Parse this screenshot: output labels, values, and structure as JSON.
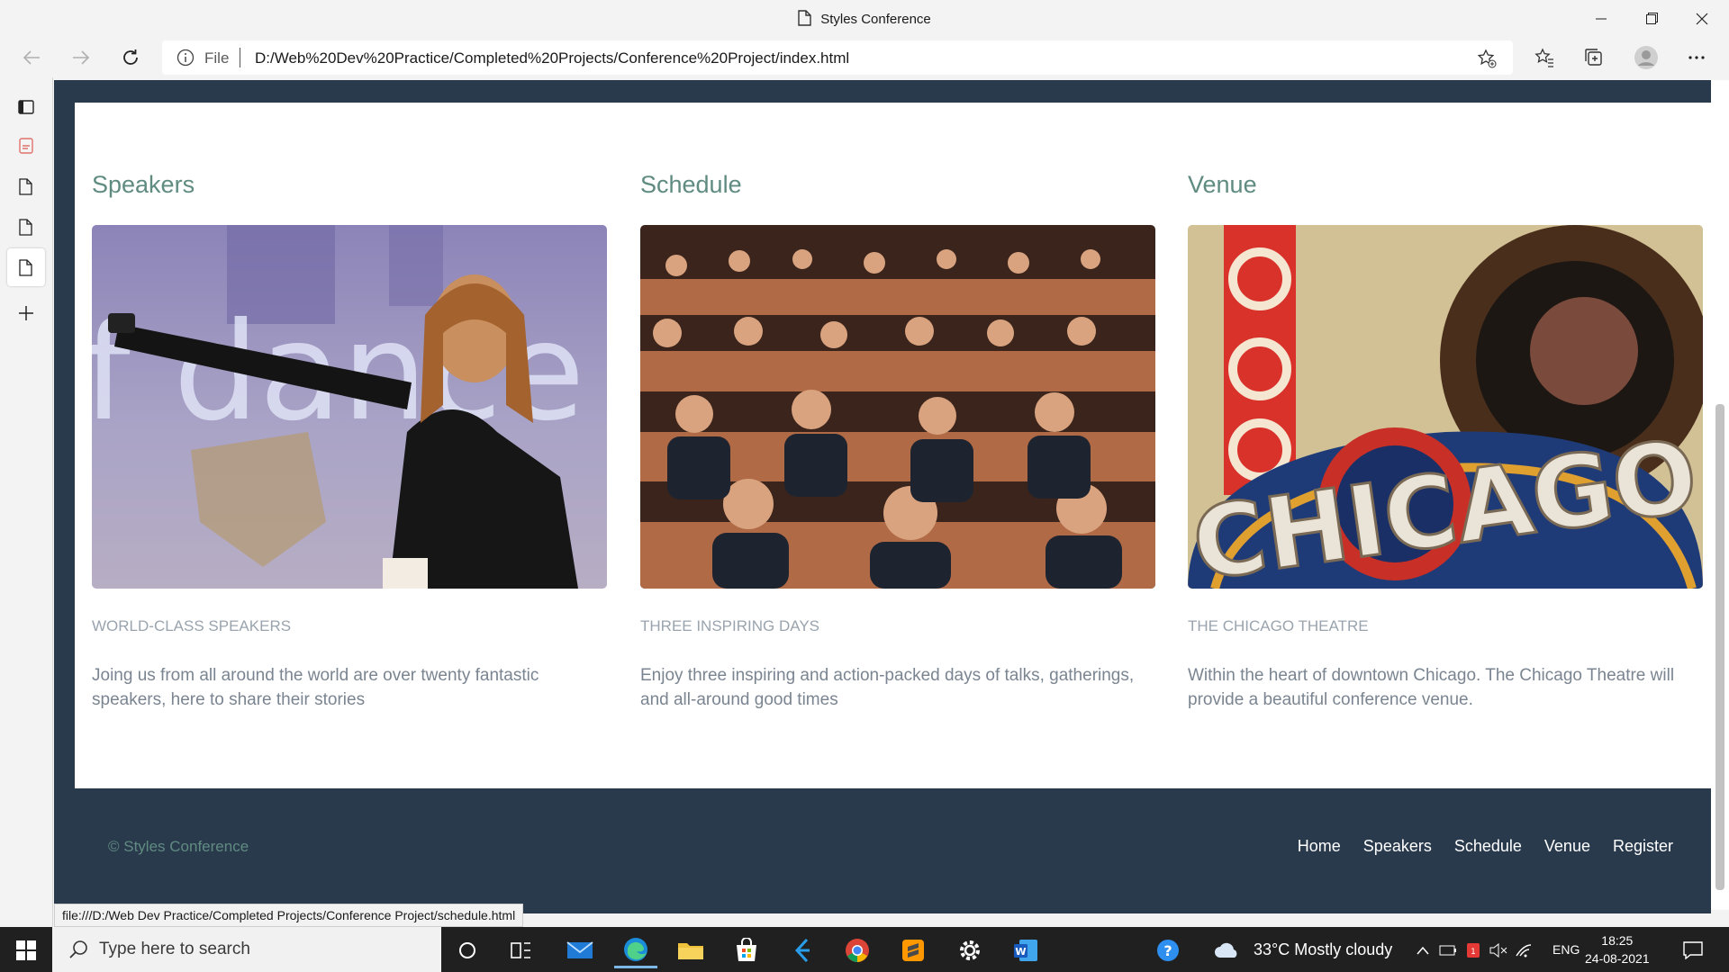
{
  "window": {
    "title": "Styles Conference"
  },
  "address_bar": {
    "scheme_label": "File",
    "url": "D:/Web%20Dev%20Practice/Completed%20Projects/Conference%20Project/index.html"
  },
  "columns": [
    {
      "heading": "Speakers",
      "subheading": "WORLD-CLASS SPEAKERS",
      "text": "Joing us from all around the world are over twenty fantastic speakers, here to share their stories",
      "image": "speaker photo"
    },
    {
      "heading": "Schedule",
      "subheading": "THREE INSPIRING DAYS",
      "text": "Enjoy three inspiring and action-packed days of talks, gatherings, and all-around good times",
      "image": "audience photo"
    },
    {
      "heading": "Venue",
      "subheading": "THE CHICAGO THEATRE",
      "text": "Within the heart of downtown Chicago. The Chicago Theatre will provide a beautiful conference venue.",
      "image": "chicago theatre sign photo",
      "sign_text": "CHICAGO"
    }
  ],
  "footer": {
    "copyright": "© Styles Conference",
    "nav": [
      "Home",
      "Speakers",
      "Schedule",
      "Venue",
      "Register"
    ]
  },
  "status_bar": {
    "hover_url": "file:///D:/Web Dev Practice/Completed Projects/Conference Project/schedule.html"
  },
  "taskbar": {
    "search_placeholder": "Type here to search",
    "weather": "33°C  Mostly cloudy",
    "language": "ENG",
    "time": "18:25",
    "date": "24-08-2021"
  },
  "colors": {
    "page_bg": "#2a3a4d",
    "heading": "#5f8b81",
    "muted_text": "#7a8591"
  }
}
